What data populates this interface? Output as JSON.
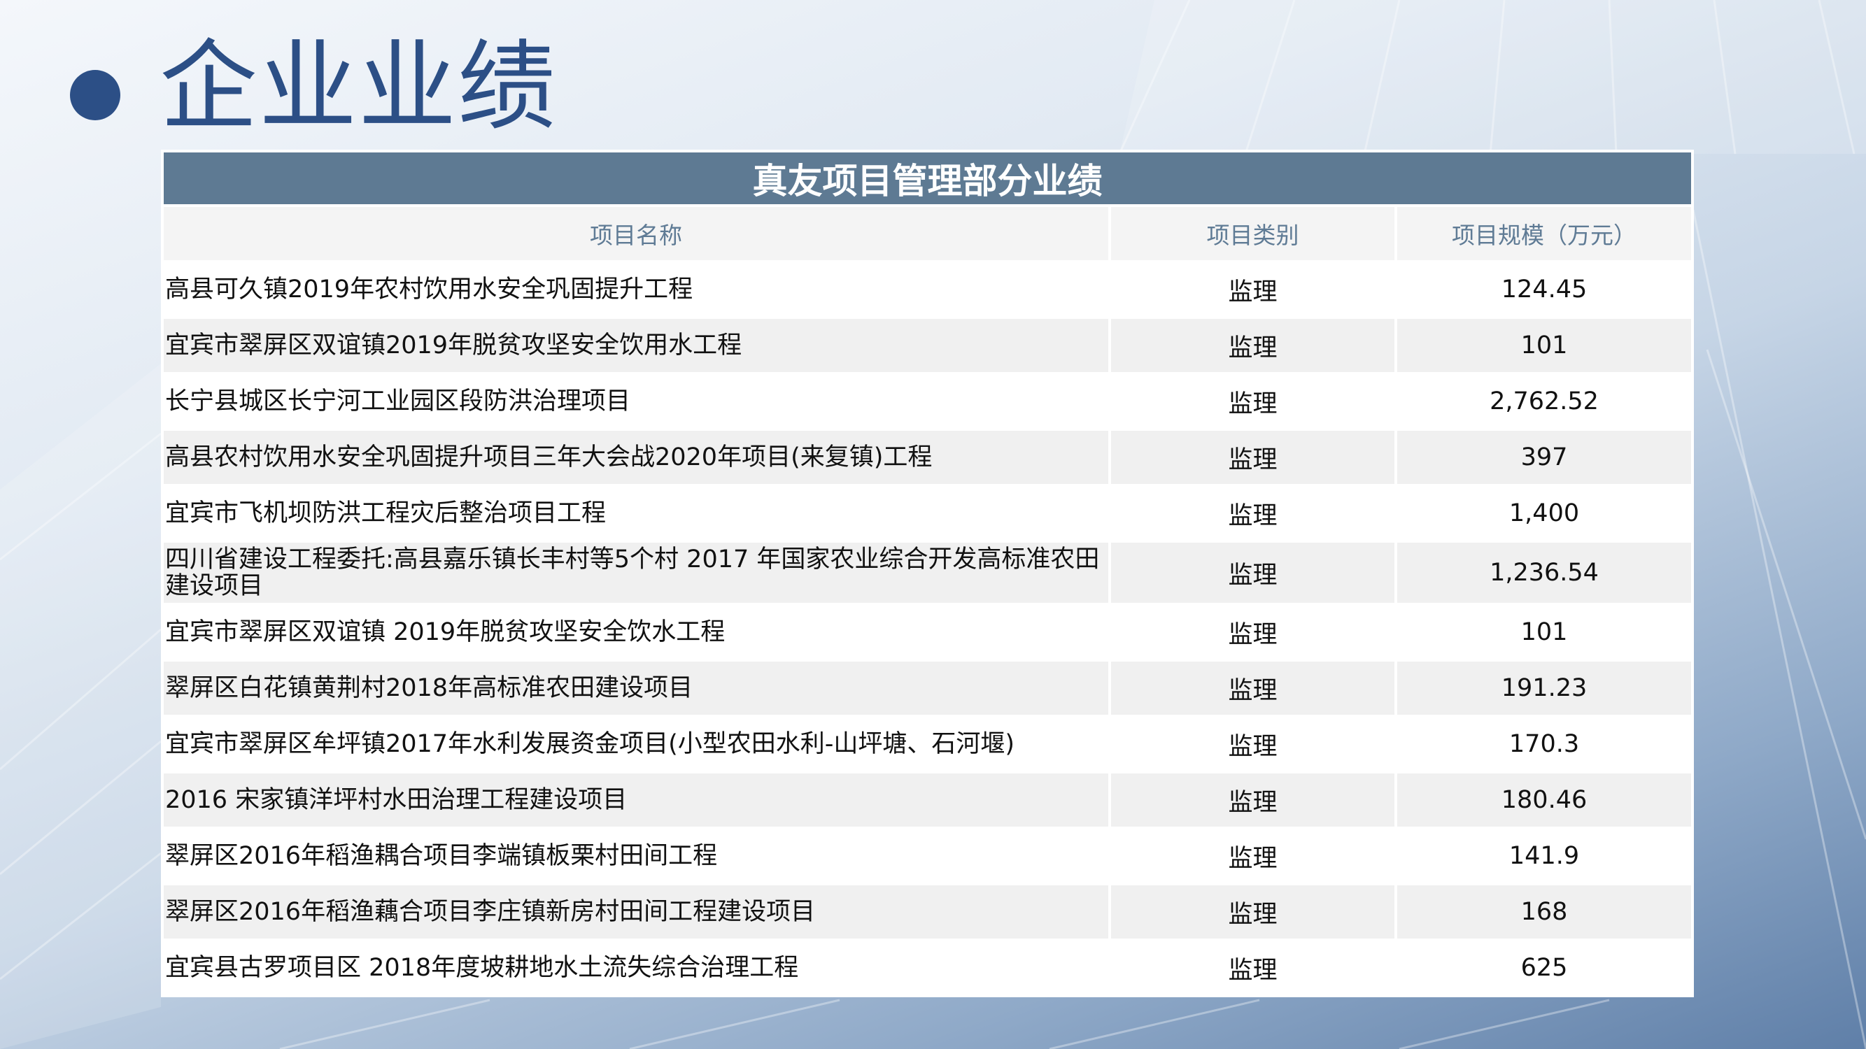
{
  "page": {
    "title": "企业业绩"
  },
  "table": {
    "caption": "真友项目管理部分业绩",
    "headers": [
      "项目名称",
      "项目类别",
      "项目规模（万元）"
    ],
    "rows": [
      {
        "name": "高县可久镇2019年农村饮用水安全巩固提升工程",
        "category": "监理",
        "scale": "124.45"
      },
      {
        "name": "宜宾市翠屏区双谊镇2019年脱贫攻坚安全饮用水工程",
        "category": "监理",
        "scale": "101"
      },
      {
        "name": "长宁县城区长宁河工业园区段防洪治理项目",
        "category": "监理",
        "scale": "2,762.52"
      },
      {
        "name": "高县农村饮用水安全巩固提升项目三年大会战2020年项目(来复镇)工程",
        "category": "监理",
        "scale": "397"
      },
      {
        "name": "宜宾市飞机坝防洪工程灾后整治项目工程",
        "category": "监理",
        "scale": "1,400"
      },
      {
        "name": "四川省建设工程委托:高县嘉乐镇长丰村等5个村 2017 年国家农业综合开发高标准农田建设项目",
        "category": "监理",
        "scale": "1,236.54"
      },
      {
        "name": "宜宾市翠屏区双谊镇 2019年脱贫攻坚安全饮水工程",
        "category": "监理",
        "scale": "101"
      },
      {
        "name": "翠屏区白花镇黄荆村2018年高标准农田建设项目",
        "category": "监理",
        "scale": "191.23"
      },
      {
        "name": "宜宾市翠屏区牟坪镇2017年水利发展资金项目(小型农田水利-山坪塘、石河堰)",
        "category": "监理",
        "scale": "170.3"
      },
      {
        "name": "2016 宋家镇洋坪村水田治理工程建设项目",
        "category": "监理",
        "scale": "180.46"
      },
      {
        "name": "翠屏区2016年稻渔耦合项目李端镇板栗村田间工程",
        "category": "监理",
        "scale": "141.9"
      },
      {
        "name": "翠屏区2016年稻渔藕合项目李庄镇新房村田间工程建设项目",
        "category": "监理",
        "scale": "168"
      },
      {
        "name": "宜宾县古罗项目区 2018年度坡耕地水土流失综合治理工程",
        "category": "监理",
        "scale": "625"
      }
    ]
  },
  "colors": {
    "accent": "#2c4f86",
    "caption_bg": "#5e7a93",
    "header_text": "#5f7b95"
  }
}
